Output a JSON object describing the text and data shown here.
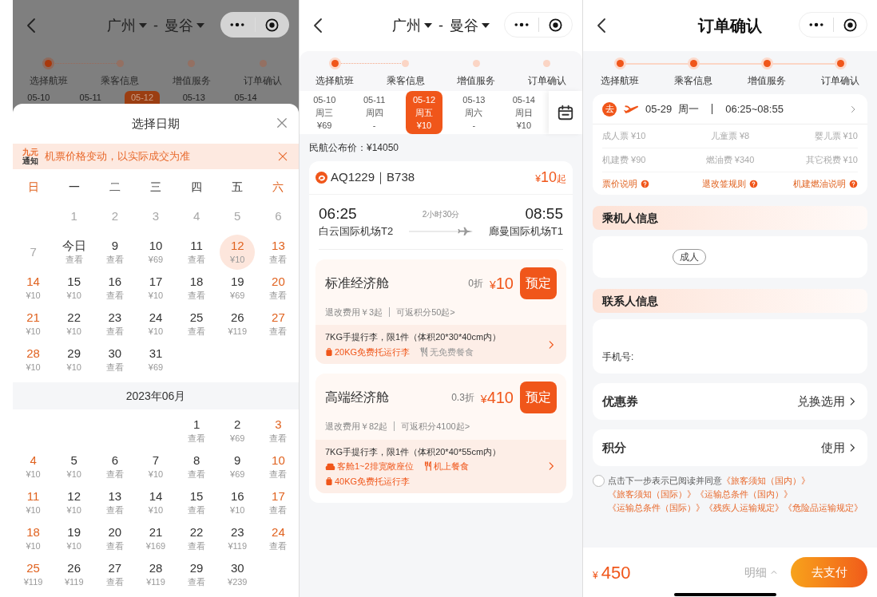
{
  "date_picker_screen": {
    "header": {
      "kind": "route",
      "from": "广州",
      "separator": "-",
      "to": "曼谷"
    },
    "steps": [
      {
        "label": "选择航班",
        "done": true
      },
      {
        "label": "乘客信息",
        "done": false
      },
      {
        "label": "增值服务",
        "done": false
      },
      {
        "label": "订单确认",
        "done": false
      }
    ],
    "dates": [
      {
        "date": "05-10",
        "selected": false
      },
      {
        "date": "05-11",
        "selected": false
      },
      {
        "date": "05-12",
        "selected": true
      },
      {
        "date": "05-13",
        "selected": false
      },
      {
        "date": "05-14",
        "selected": false
      }
    ],
    "sheet": {
      "title": "选择日期",
      "notice": {
        "badge": [
          "九元",
          "通知"
        ],
        "text": "机票价格变动，以实际成交为准"
      },
      "weekdays": [
        "日",
        "一",
        "二",
        "三",
        "四",
        "五",
        "六"
      ],
      "months": [
        {
          "days": [
            {
              "kind": "blank"
            },
            {
              "kind": "day",
              "day": "1",
              "disabled": true,
              "selected": false
            },
            {
              "kind": "day",
              "day": "2",
              "disabled": true,
              "selected": false
            },
            {
              "kind": "day",
              "day": "3",
              "disabled": true,
              "selected": false
            },
            {
              "kind": "day",
              "day": "4",
              "disabled": true,
              "selected": false
            },
            {
              "kind": "day",
              "day": "5",
              "disabled": true,
              "selected": false
            },
            {
              "kind": "day",
              "day": "6",
              "disabled": true,
              "selected": false
            },
            {
              "kind": "day",
              "day": "7",
              "disabled": true,
              "selected": false
            },
            {
              "kind": "day",
              "day": "今日",
              "sub": "查看",
              "disabled": false,
              "selected": false
            },
            {
              "kind": "day",
              "day": "9",
              "sub": "查看",
              "disabled": false,
              "selected": false
            },
            {
              "kind": "day",
              "day": "10",
              "sub": "¥69",
              "disabled": false,
              "selected": false
            },
            {
              "kind": "day",
              "day": "11",
              "sub": "查看",
              "disabled": false,
              "selected": false
            },
            {
              "kind": "day",
              "day": "12",
              "sub": "¥10",
              "disabled": false,
              "selected": true
            },
            {
              "kind": "day",
              "day": "13",
              "sub": "查看",
              "disabled": false,
              "selected": false
            },
            {
              "kind": "day",
              "day": "14",
              "sub": "¥10",
              "disabled": false,
              "selected": false
            },
            {
              "kind": "day",
              "day": "15",
              "sub": "¥10",
              "disabled": false,
              "selected": false
            },
            {
              "kind": "day",
              "day": "16",
              "sub": "查看",
              "disabled": false,
              "selected": false
            },
            {
              "kind": "day",
              "day": "17",
              "sub": "¥10",
              "disabled": false,
              "selected": false
            },
            {
              "kind": "day",
              "day": "18",
              "sub": "查看",
              "disabled": false,
              "selected": false
            },
            {
              "kind": "day",
              "day": "19",
              "sub": "¥69",
              "disabled": false,
              "selected": false
            },
            {
              "kind": "day",
              "day": "20",
              "sub": "查看",
              "disabled": false,
              "selected": false
            },
            {
              "kind": "day",
              "day": "21",
              "sub": "¥10",
              "disabled": false,
              "selected": false
            },
            {
              "kind": "day",
              "day": "22",
              "sub": "¥10",
              "disabled": false,
              "selected": false
            },
            {
              "kind": "day",
              "day": "23",
              "sub": "查看",
              "disabled": false,
              "selected": false
            },
            {
              "kind": "day",
              "day": "24",
              "sub": "¥10",
              "disabled": false,
              "selected": false
            },
            {
              "kind": "day",
              "day": "25",
              "sub": "查看",
              "disabled": false,
              "selected": false
            },
            {
              "kind": "day",
              "day": "26",
              "sub": "¥119",
              "disabled": false,
              "selected": false
            },
            {
              "kind": "day",
              "day": "27",
              "sub": "查看",
              "disabled": false,
              "selected": false
            },
            {
              "kind": "day",
              "day": "28",
              "sub": "¥10",
              "disabled": false,
              "selected": false
            },
            {
              "kind": "day",
              "day": "29",
              "sub": "¥10",
              "disabled": false,
              "selected": false
            },
            {
              "kind": "day",
              "day": "30",
              "sub": "查看",
              "disabled": false,
              "selected": false
            },
            {
              "kind": "day",
              "day": "31",
              "sub": "¥69",
              "disabled": false,
              "selected": false
            }
          ]
        },
        {
          "title": "2023年06月",
          "days": [
            {
              "kind": "blank"
            },
            {
              "kind": "blank"
            },
            {
              "kind": "blank"
            },
            {
              "kind": "blank"
            },
            {
              "kind": "day",
              "day": "1",
              "sub": "查看",
              "disabled": false,
              "selected": false
            },
            {
              "kind": "day",
              "day": "2",
              "sub": "¥69",
              "disabled": false,
              "selected": false
            },
            {
              "kind": "day",
              "day": "3",
              "sub": "查看",
              "disabled": false,
              "selected": false
            },
            {
              "kind": "day",
              "day": "4",
              "sub": "¥10",
              "disabled": false,
              "selected": false
            },
            {
              "kind": "day",
              "day": "5",
              "sub": "¥10",
              "disabled": false,
              "selected": false
            },
            {
              "kind": "day",
              "day": "6",
              "sub": "查看",
              "disabled": false,
              "selected": false
            },
            {
              "kind": "day",
              "day": "7",
              "sub": "¥10",
              "disabled": false,
              "selected": false
            },
            {
              "kind": "day",
              "day": "8",
              "sub": "查看",
              "disabled": false,
              "selected": false
            },
            {
              "kind": "day",
              "day": "9",
              "sub": "¥69",
              "disabled": false,
              "selected": false
            },
            {
              "kind": "day",
              "day": "10",
              "sub": "查看",
              "disabled": false,
              "selected": false
            },
            {
              "kind": "day",
              "day": "11",
              "sub": "¥10",
              "disabled": false,
              "selected": false
            },
            {
              "kind": "day",
              "day": "12",
              "sub": "¥10",
              "disabled": false,
              "selected": false
            },
            {
              "kind": "day",
              "day": "13",
              "sub": "查看",
              "disabled": false,
              "selected": false
            },
            {
              "kind": "day",
              "day": "14",
              "sub": "¥10",
              "disabled": false,
              "selected": false
            },
            {
              "kind": "day",
              "day": "15",
              "sub": "查看",
              "disabled": false,
              "selected": false
            },
            {
              "kind": "day",
              "day": "16",
              "sub": "¥10",
              "disabled": false,
              "selected": false
            },
            {
              "kind": "day",
              "day": "17",
              "sub": "查看",
              "disabled": false,
              "selected": false
            },
            {
              "kind": "day",
              "day": "18",
              "sub": "¥10",
              "disabled": false,
              "selected": false
            },
            {
              "kind": "day",
              "day": "19",
              "sub": "¥10",
              "disabled": false,
              "selected": false
            },
            {
              "kind": "day",
              "day": "20",
              "sub": "查看",
              "disabled": false,
              "selected": false
            },
            {
              "kind": "day",
              "day": "21",
              "sub": "¥169",
              "disabled": false,
              "selected": false
            },
            {
              "kind": "day",
              "day": "22",
              "sub": "查看",
              "disabled": false,
              "selected": false
            },
            {
              "kind": "day",
              "day": "23",
              "sub": "¥119",
              "disabled": false,
              "selected": false
            },
            {
              "kind": "day",
              "day": "24",
              "sub": "查看",
              "disabled": false,
              "selected": false
            },
            {
              "kind": "day",
              "day": "25",
              "sub": "¥119",
              "disabled": false,
              "selected": false
            },
            {
              "kind": "day",
              "day": "26",
              "sub": "¥119",
              "disabled": false,
              "selected": false
            },
            {
              "kind": "day",
              "day": "27",
              "sub": "查看",
              "disabled": false,
              "selected": false
            },
            {
              "kind": "day",
              "day": "28",
              "sub": "¥119",
              "disabled": false,
              "selected": false
            },
            {
              "kind": "day",
              "day": "29",
              "sub": "查看",
              "disabled": false,
              "selected": false
            },
            {
              "kind": "day",
              "day": "30",
              "sub": "¥239",
              "disabled": false,
              "selected": false
            }
          ]
        }
      ]
    }
  },
  "flight_select_screen": {
    "header": {
      "kind": "route",
      "from": "广州",
      "separator": "-",
      "to": "曼谷"
    },
    "steps": [
      {
        "label": "选择航班",
        "done": true
      },
      {
        "label": "乘客信息",
        "done": false
      },
      {
        "label": "增值服务",
        "done": false
      },
      {
        "label": "订单确认",
        "done": false
      }
    ],
    "dates": [
      {
        "date": "05-10",
        "weekday": "周三",
        "price": "¥69",
        "selected": false
      },
      {
        "date": "05-11",
        "weekday": "周四",
        "price": "-",
        "selected": false
      },
      {
        "date": "05-12",
        "weekday": "周五",
        "price": "¥10",
        "selected": true
      },
      {
        "date": "05-13",
        "weekday": "周六",
        "price": "-",
        "selected": false
      },
      {
        "date": "05-14",
        "weekday": "周日",
        "price": "¥10",
        "selected": false
      }
    ],
    "published_fare": "民航公布价：¥14050",
    "flight": {
      "code": "AQ1229｜B738",
      "price": {
        "currency": "¥",
        "amount": "10",
        "suffix": "起"
      },
      "depart_time": "06:25",
      "duration": "2小时30分",
      "arrive_time": "08:55",
      "depart_airport": "白云国际机场T2",
      "arrive_airport": "廊曼国际机场T1",
      "cabins": [
        {
          "name": "标准经济舱",
          "discount": "0折",
          "currency": "¥",
          "amount": "10",
          "button": "预定",
          "refund": "退改费用￥3起",
          "points": "可返积分50起>",
          "baggage": "7KG手提行李，限1件（体积20*30*40cm内）",
          "perks": [
            {
              "kind": "luggage",
              "text": "20KG免费托运行李",
              "available": true
            },
            {
              "kind": "meal",
              "text": "无免费餐食",
              "available": false
            }
          ]
        },
        {
          "name": "高端经济舱",
          "discount": "0.3折",
          "currency": "¥",
          "amount": "410",
          "button": "预定",
          "refund": "退改费用￥82起",
          "points": "可返积分4100起>",
          "baggage": "7KG手提行李，限1件（体积20*40*55cm内）",
          "perks": [
            {
              "kind": "seat",
              "text": "客舱1~2排宽敞座位",
              "available": true
            },
            {
              "kind": "meal",
              "text": "机上餐食",
              "available": true
            },
            {
              "kind": "luggage",
              "text": "40KG免费托运行李",
              "available": true
            }
          ]
        }
      ]
    }
  },
  "order_confirm_screen": {
    "header": {
      "kind": "title",
      "title": "订单确认"
    },
    "steps": [
      {
        "label": "选择航班",
        "done": true
      },
      {
        "label": "乘客信息",
        "done": true
      },
      {
        "label": "增值服务",
        "done": true
      },
      {
        "label": "订单确认",
        "done": true
      }
    ],
    "trip": {
      "badge": "去",
      "date": "05-29",
      "weekday": "周一",
      "time": "06:25~08:55"
    },
    "fares": [
      "成人票 ¥10",
      "儿童票 ¥8",
      "婴儿票 ¥10",
      "机建费 ¥90",
      "燃油费 ¥340",
      "其它税费 ¥10"
    ],
    "links": [
      "票价说明",
      "退改签规则",
      "机建燃油说明"
    ],
    "passenger_section": {
      "title": "乘机人信息",
      "tag": "成人"
    },
    "contact_section": {
      "title": "联系人信息",
      "phone_label": "手机号:"
    },
    "options": [
      {
        "label": "优惠券",
        "action": "兑换选用"
      },
      {
        "label": "积分",
        "action": "使用"
      }
    ],
    "agreement": {
      "checked": false,
      "text": "点击下一步表示已阅读并同意",
      "links": [
        "《旅客须知（国内）》",
        "《旅客须知（国际）》",
        "《运输总条件（国内）》",
        "《运输总条件（国际）》",
        "《残疾人运输规定》",
        "《危险品运输规定》"
      ]
    },
    "footer": {
      "currency": "¥",
      "amount": "450",
      "details": "明细",
      "pay_button": "去支付"
    }
  }
}
